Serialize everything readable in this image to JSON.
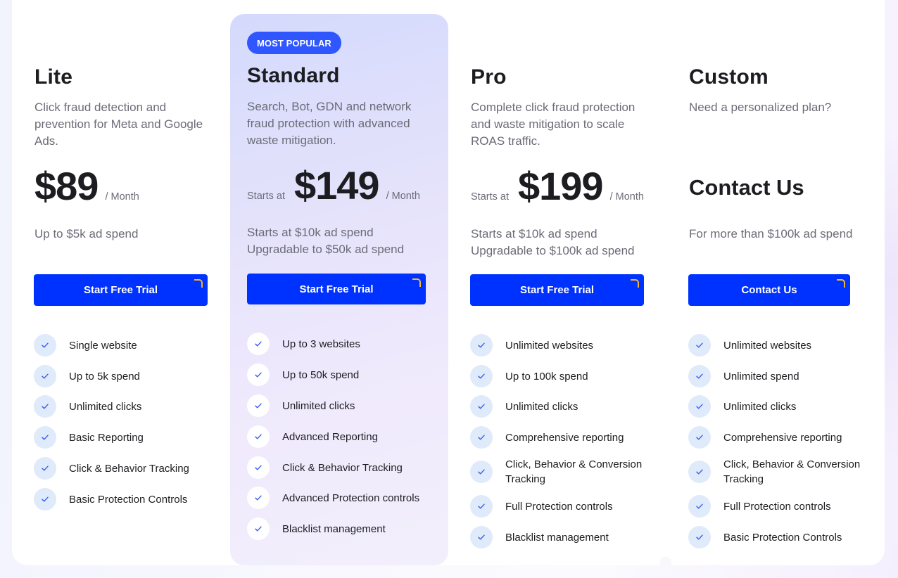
{
  "colors": {
    "accent": "#0032ff",
    "badge": "#2f56ff",
    "button_corner": "#f5b82a",
    "check_bg": "#dfeafb",
    "check_mark": "#3a5cf0"
  },
  "plans": [
    {
      "name": "Lite",
      "description": "Click fraud detection and prevention for Meta and Google Ads.",
      "starts_at": "",
      "price": "$89",
      "period": "/ Month",
      "spend": [
        "Up to $5k ad spend"
      ],
      "cta": "Start Free Trial",
      "features": [
        "Single website",
        "Up to 5k spend",
        "Unlimited clicks",
        "Basic Reporting",
        "Click & Behavior Tracking",
        "Basic Protection Controls"
      ]
    },
    {
      "name": "Standard",
      "badge": "MOST POPULAR",
      "description": "Search, Bot, GDN and network fraud protection with advanced waste mitigation.",
      "starts_at": "Starts at",
      "price": "$149",
      "period": "/ Month",
      "spend": [
        "Starts at $10k ad spend",
        "Upgradable to $50k ad spend"
      ],
      "cta": "Start Free Trial",
      "features": [
        "Up to 3 websites",
        "Up to 50k spend",
        "Unlimited clicks",
        "Advanced Reporting",
        "Click & Behavior Tracking",
        "Advanced Protection controls",
        "Blacklist management"
      ]
    },
    {
      "name": "Pro",
      "description": "Complete click fraud protection and waste mitigation to scale ROAS traffic.",
      "starts_at": "Starts at",
      "price": "$199",
      "period": "/ Month",
      "spend": [
        "Starts at $10k ad spend",
        "Upgradable to $100k ad spend"
      ],
      "cta": "Start Free Trial",
      "features": [
        "Unlimited websites",
        "Up to 100k spend",
        "Unlimited clicks",
        "Comprehensive reporting",
        "Click, Behavior & Conversion Tracking",
        "Full Protection controls",
        "Blacklist management"
      ]
    },
    {
      "name": "Custom",
      "description": "Need a personalized plan?",
      "contact_heading": "Contact Us",
      "spend": [
        "For more than $100k ad spend"
      ],
      "cta": "Contact Us",
      "features": [
        "Unlimited websites",
        "Unlimited spend",
        "Unlimited clicks",
        "Comprehensive reporting",
        "Click, Behavior & Conversion Tracking",
        "Full Protection controls",
        "Basic Protection Controls"
      ]
    }
  ]
}
